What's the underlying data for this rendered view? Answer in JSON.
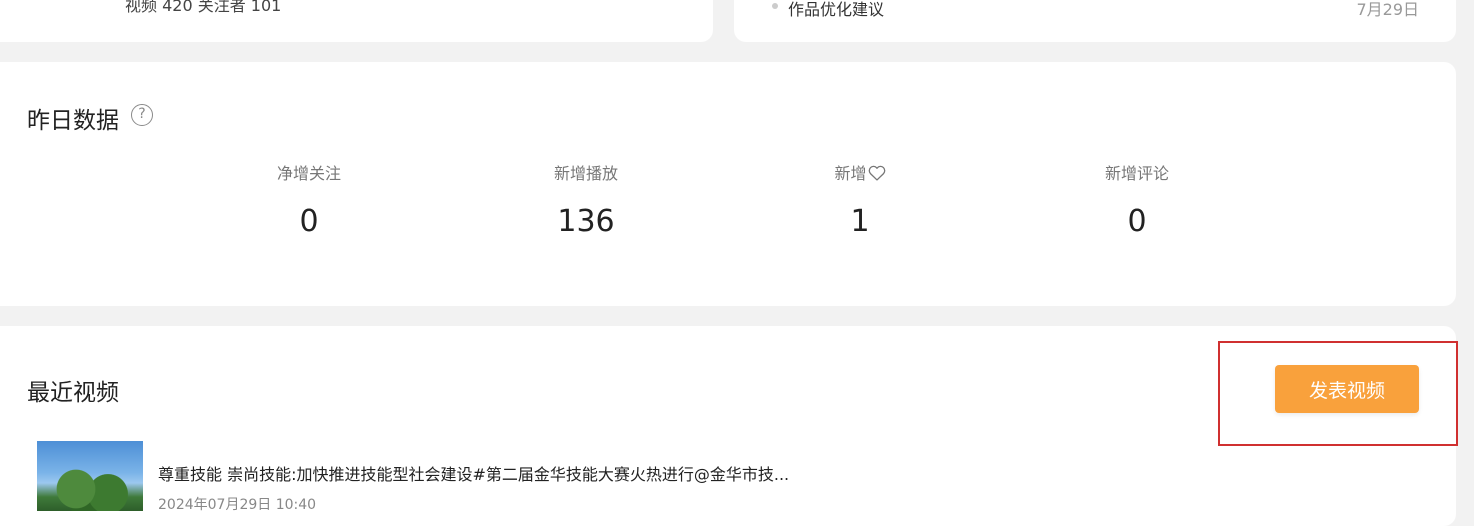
{
  "profile": {
    "counts_partial": "视频 420    关注者 101"
  },
  "notice": {
    "item_title": "作品优化建议",
    "item_date": "7月29日"
  },
  "yesterday": {
    "title": "昨日数据",
    "help_icon": "question-circle-icon",
    "stats": [
      {
        "label": "净增关注",
        "value": "0"
      },
      {
        "label": "新增播放",
        "value": "136"
      },
      {
        "label": "新增",
        "value": "1",
        "icon": "heart-outline-icon"
      },
      {
        "label": "新增评论",
        "value": "0"
      }
    ]
  },
  "recent": {
    "title": "最近视频",
    "publish_label": "发表视频",
    "videos": [
      {
        "title": "尊重技能 崇尚技能:加快推进技能型社会建设#第二届金华技能大赛火热进行@金华市技...",
        "meta": "2024年07月29日 10:40"
      }
    ]
  },
  "colors": {
    "accent": "#f9a13c",
    "highlight": "#d03030",
    "background": "#f2f2f2"
  }
}
